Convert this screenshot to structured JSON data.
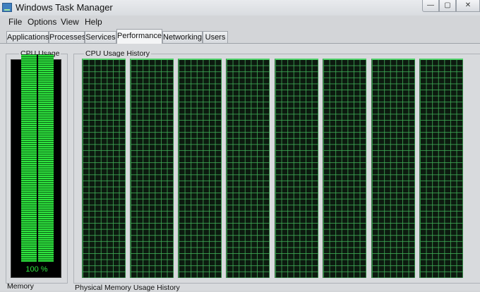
{
  "window": {
    "title": "Windows Task Manager",
    "controls": {
      "minimize": "—",
      "maximize": "▢",
      "close": "✕"
    }
  },
  "menu": [
    "File",
    "Options",
    "View",
    "Help"
  ],
  "tabs": [
    {
      "label": "Applications",
      "active": false
    },
    {
      "label": "Processes",
      "active": false
    },
    {
      "label": "Services",
      "active": false
    },
    {
      "label": "Performance",
      "active": true
    },
    {
      "label": "Networking",
      "active": false
    },
    {
      "label": "Users",
      "active": false
    }
  ],
  "performance": {
    "cpu_usage_label": "CPU Usage",
    "cpu_usage_value": "100 %",
    "cpu_usage_percent": 100,
    "cpu_history_label": "CPU Usage History",
    "cpu_history_cores": 8,
    "memory_label": "Memory",
    "physical_memory_history_label": "Physical Memory Usage History"
  },
  "colors": {
    "graph_green": "#2fe43f",
    "graph_bg": "#0c1a0f",
    "grid_line": "#3fac56"
  }
}
